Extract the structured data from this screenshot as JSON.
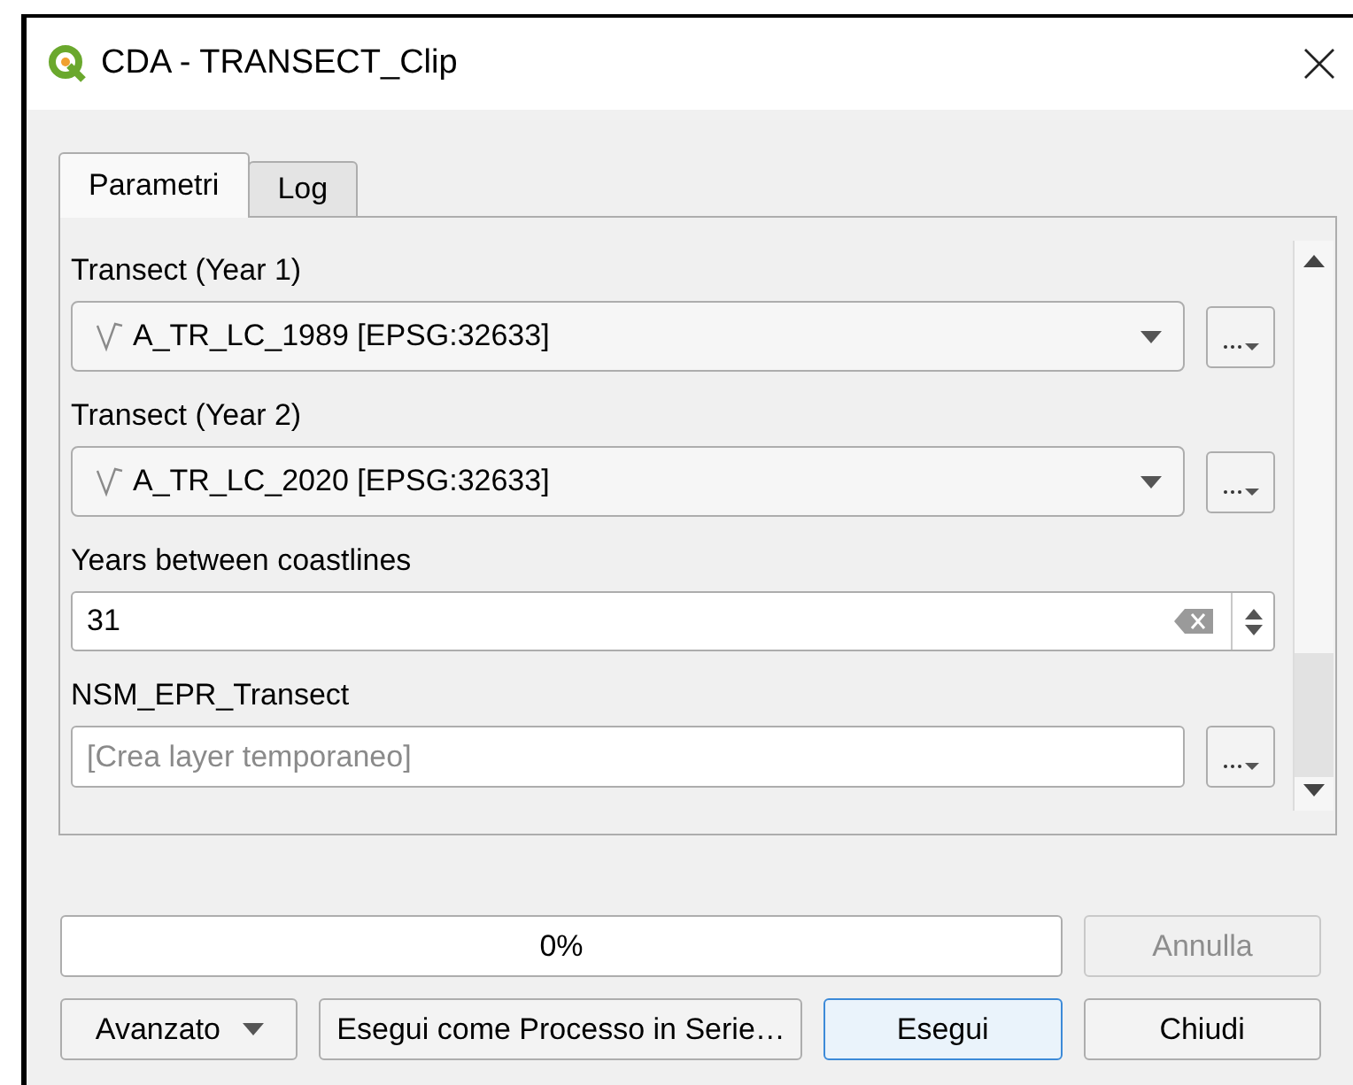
{
  "window": {
    "title": "CDA - TRANSECT_Clip"
  },
  "tabs": [
    {
      "label": "Parametri",
      "selected": true
    },
    {
      "label": "Log",
      "selected": false
    }
  ],
  "parameters": [
    {
      "kind": "layer",
      "label": "Transect (Year 1)",
      "value": "A_TR_LC_1989 [EPSG:32633]"
    },
    {
      "kind": "layer",
      "label": "Transect (Year 2)",
      "value": "A_TR_LC_2020 [EPSG:32633]"
    },
    {
      "kind": "number",
      "label": "Years between coastlines",
      "value": "31"
    },
    {
      "kind": "output",
      "label": "NSM_EPR_Transect",
      "placeholder": "[Crea layer temporaneo]"
    }
  ],
  "progress": {
    "level": 0,
    "reading": "0%"
  },
  "buttons": [
    {
      "kind": "cancel",
      "label": "Annulla",
      "disabled": true
    },
    {
      "kind": "menu",
      "label": "Avanzato",
      "disabled": false
    },
    {
      "kind": "plain",
      "label": "Esegui come Processo in Serie…",
      "disabled": false
    },
    {
      "kind": "default",
      "label": "Esegui",
      "disabled": false
    },
    {
      "kind": "plain",
      "label": "Chiudi",
      "disabled": false
    }
  ]
}
